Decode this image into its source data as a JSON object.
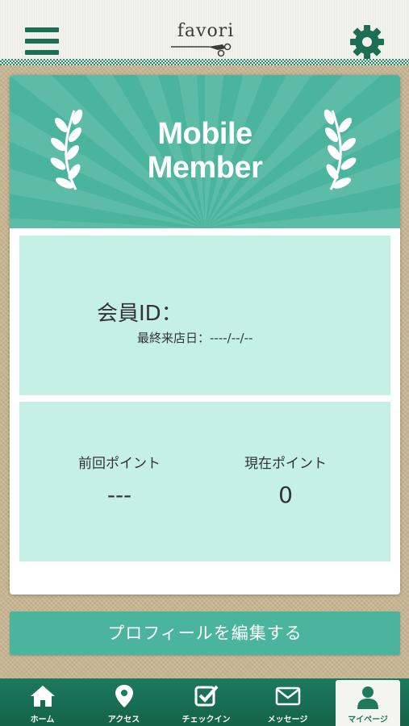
{
  "header": {
    "logo_text": "favori",
    "menu_icon": "hamburger-menu-icon",
    "settings_icon": "gear-icon",
    "accent": "#1e6e55"
  },
  "banner": {
    "title_line1": "Mobile",
    "title_line2": "Member",
    "color": "#4bb49c"
  },
  "member": {
    "id_label": "会員ID：",
    "last_visit": "最終来店日：----/--/--"
  },
  "points": {
    "previous_label": "前回ポイント",
    "previous_value": "---",
    "current_label": "現在ポイント",
    "current_value": "0"
  },
  "edit_profile_label": "プロフィールを編集する",
  "tabs": [
    {
      "label": "ホーム",
      "icon": "home-icon"
    },
    {
      "label": "アクセス",
      "icon": "map-pin-icon"
    },
    {
      "label": "チェックイン",
      "icon": "checkbox-icon"
    },
    {
      "label": "メッセージ",
      "icon": "envelope-icon"
    },
    {
      "label": "マイページ",
      "icon": "user-icon",
      "active": true
    }
  ]
}
